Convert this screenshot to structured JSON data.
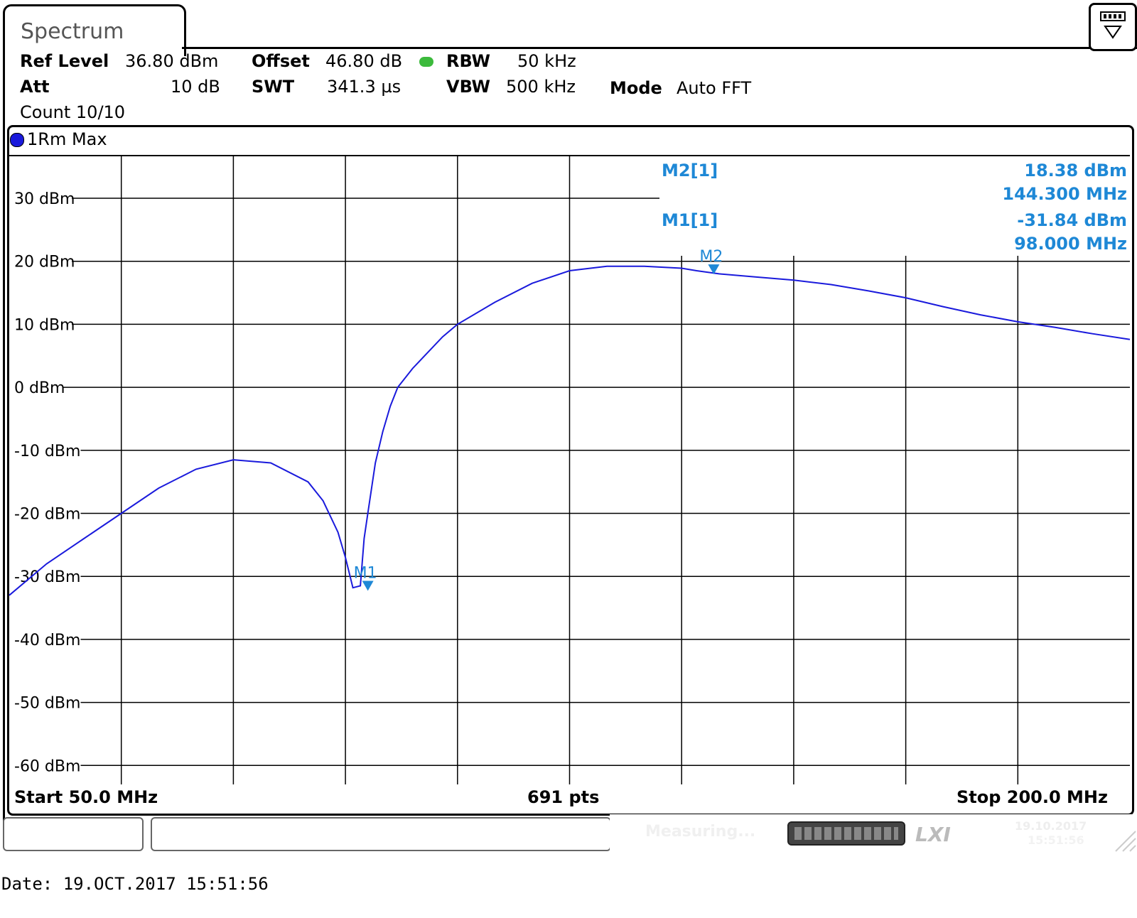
{
  "window": {
    "tab_title": "Spectrum",
    "status_text": "Measuring...",
    "status_date": "19.10.2017",
    "status_time": "15:51:56",
    "lxi_logo": "LXI"
  },
  "settings": {
    "ref_level_label": "Ref Level",
    "ref_level_value": "36.80 dBm",
    "offset_label": "Offset",
    "offset_value": "46.80 dB",
    "rbw_label": "RBW",
    "rbw_value": "50 kHz",
    "att_label": "Att",
    "att_value": "10 dB",
    "swt_label": "SWT",
    "swt_value": "341.3 µs",
    "vbw_label": "VBW",
    "vbw_value": "500 kHz",
    "mode_label": "Mode",
    "mode_value": "Auto FFT",
    "count_text": "Count 10/10"
  },
  "trace_label": "1Rm Max",
  "footer": {
    "start": "Start 50.0 MHz",
    "points": "691 pts",
    "stop": "Stop 200.0 MHz",
    "date_line": "Date: 19.OCT.2017  15:51:56"
  },
  "colors": {
    "trace": "#1a1adc",
    "marker": "#1e88d6",
    "grid": "#000000"
  },
  "chart_data": {
    "type": "line",
    "xlim": [
      50.0,
      200.0
    ],
    "ylim": [
      -70,
      36.8
    ],
    "xunit": "MHz",
    "yunit": "dBm",
    "grid": true,
    "y_tick_labels": [
      "30 dBm",
      "20 dBm",
      "10 dBm",
      "0 dBm",
      "-10 dBm",
      "-20 dBm",
      "-30 dBm",
      "-40 dBm",
      "-50 dBm",
      "-60 dBm"
    ],
    "y_ticks": [
      30,
      20,
      10,
      0,
      -10,
      -20,
      -30,
      -40,
      -50,
      -60
    ],
    "series": [
      {
        "name": "1Rm Max",
        "x": [
          50,
          55,
          60,
          65,
          70,
          75,
          80,
          85,
          90,
          92,
          94,
          95,
          96,
          97,
          97.5,
          98,
          98.5,
          99,
          100,
          101,
          102,
          104,
          106,
          108,
          110,
          115,
          120,
          125,
          130,
          135,
          140,
          142,
          145,
          150,
          155,
          160,
          165,
          170,
          175,
          180,
          185,
          190,
          195,
          200
        ],
        "y": [
          -33,
          -28,
          -24,
          -20,
          -16,
          -13,
          -11.5,
          -12,
          -15,
          -18,
          -23,
          -27,
          -31.8,
          -31.5,
          -24,
          -20,
          -16,
          -12,
          -7,
          -3,
          0,
          3,
          5.5,
          8,
          10,
          13.5,
          16.5,
          18.5,
          19.2,
          19.2,
          18.9,
          18.5,
          18,
          17.5,
          17,
          16.3,
          15.3,
          14.2,
          12.8,
          11.5,
          10.4,
          9.5,
          8.5,
          7.6
        ]
      }
    ],
    "markers": [
      {
        "label": "M1",
        "x": 98.0,
        "y": -31.84
      },
      {
        "label": "M2",
        "x": 144.3,
        "y": 18.38
      }
    ],
    "marker_table": [
      {
        "name": "M2[1]",
        "level": "18.38 dBm",
        "freq": "144.300 MHz"
      },
      {
        "name": "M1[1]",
        "level": "-31.84 dBm",
        "freq": "98.000 MHz"
      }
    ]
  }
}
